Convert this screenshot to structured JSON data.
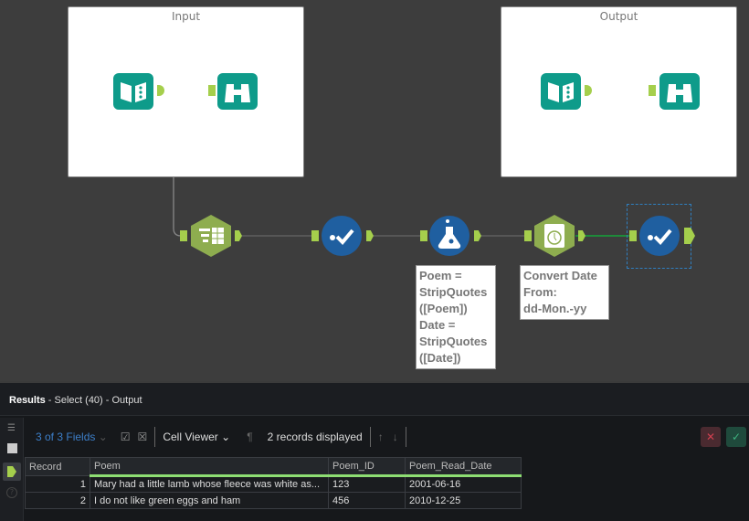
{
  "canvas": {
    "containers": [
      {
        "title": "Input"
      },
      {
        "title": "Output"
      }
    ],
    "annotations": {
      "formula": "Poem =\nStripQuotes\n([Poem])\nDate =\nStripQuotes\n([Date])",
      "datetime": "Convert Date\nFrom:\ndd-Mon.-yy"
    }
  },
  "results": {
    "title": "Results",
    "subtitle": " - Select (40) - Output",
    "fields_label": "3 of 3 Fields",
    "viewer_label": "Cell Viewer",
    "records_label": "2 records displayed",
    "columns": [
      "Record",
      "Poem",
      "Poem_ID",
      "Poem_Read_Date"
    ],
    "rows": [
      {
        "record": "1",
        "poem": "Mary had a little lamb whose fleece was white as...",
        "id": "123",
        "date": "2001-06-16"
      },
      {
        "record": "2",
        "poem": "I do not like green eggs and ham",
        "id": "456",
        "date": "2010-12-25"
      }
    ]
  },
  "colors": {
    "accent": "#a5cf4c",
    "select_tool": "#1f5fa0",
    "input_tool": "#0e9b8a",
    "prep_tool": "#8ead4f"
  }
}
